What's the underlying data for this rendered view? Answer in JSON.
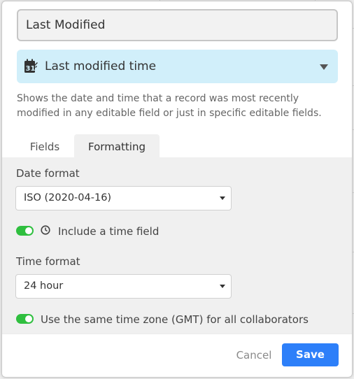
{
  "field": {
    "name_value": "Last Modified",
    "type_label": "Last modified time",
    "description": "Shows the date and time that a record was most recently modified in any editable field or just in specific editable fields."
  },
  "tabs": [
    {
      "label": "Fields",
      "active": false
    },
    {
      "label": "Formatting",
      "active": true
    }
  ],
  "formatting": {
    "date_format_label": "Date format",
    "date_format_value": "ISO (2020-04-16)",
    "include_time_label": "Include a time field",
    "include_time_enabled": true,
    "time_format_label": "Time format",
    "time_format_value": "24 hour",
    "same_timezone_label": "Use the same time zone (GMT) for all collaborators",
    "same_timezone_enabled": true
  },
  "footer": {
    "cancel_label": "Cancel",
    "save_label": "Save"
  },
  "colors": {
    "accent": "#2d7ff9",
    "toggle_on": "#2fbf3f",
    "type_bg": "#d1effa"
  },
  "icons": {
    "type_icon": "calendar-edit-icon",
    "time_icon": "clock-icon",
    "caret": "chevron-down-icon"
  }
}
